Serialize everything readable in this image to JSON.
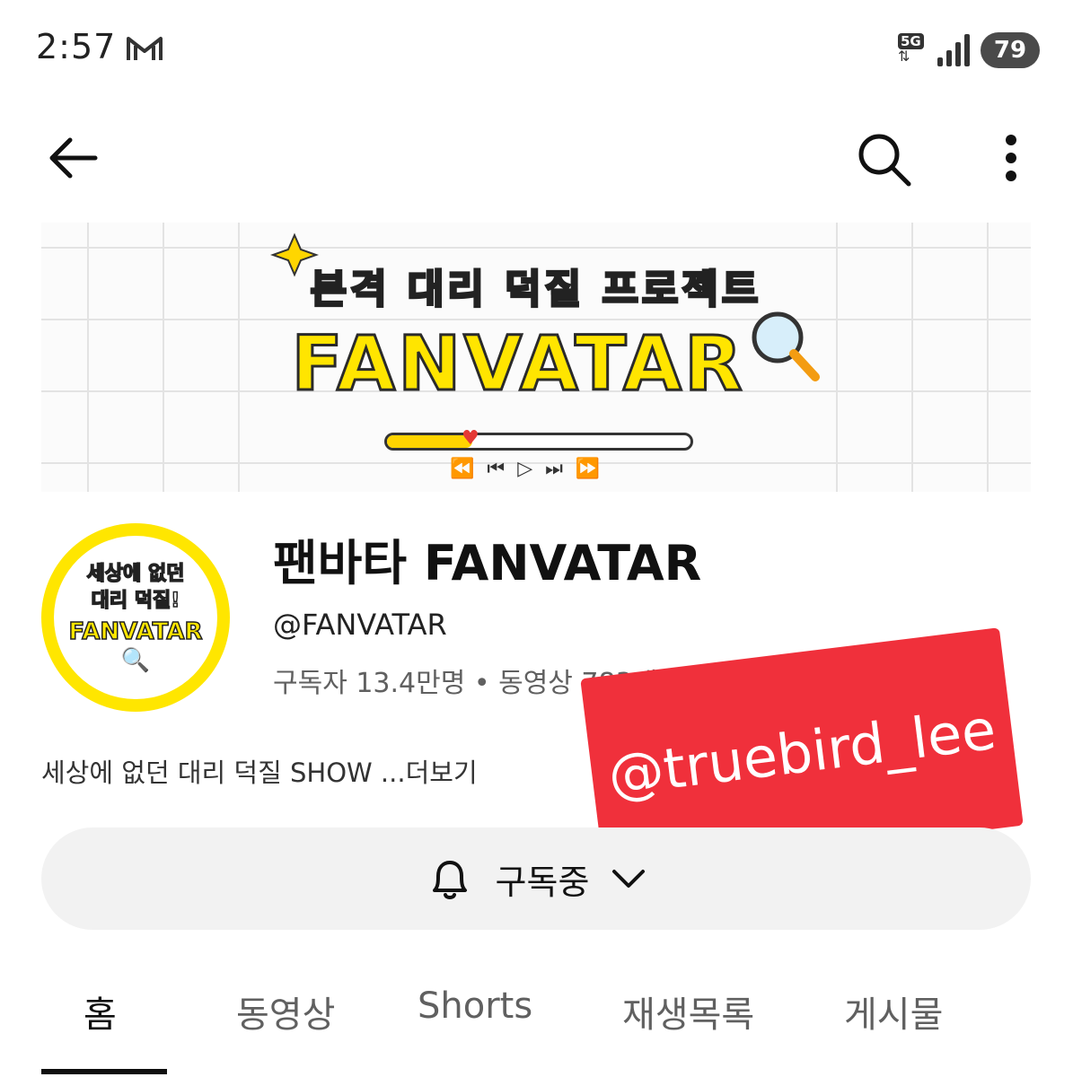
{
  "status_bar": {
    "time": "2:57",
    "network": "5G",
    "battery": "79",
    "icons": [
      "gmail-icon",
      "network-5g-icon",
      "signal-icon",
      "battery-icon"
    ]
  },
  "top_bar": {
    "icons": [
      "back-arrow-icon",
      "search-icon",
      "more-vert-icon"
    ]
  },
  "banner": {
    "subtitle": "본격 대리 덕질 프로젝트",
    "title": "FANVATAR",
    "progress": 0.28,
    "colors": {
      "title": "#ffe500",
      "accent": "#e53935"
    }
  },
  "avatar": {
    "line1": "세상에 없던",
    "line2": "대리 덕질!",
    "brand": "FANVATAR"
  },
  "channel": {
    "name": "팬바타 FANVATAR",
    "handle": "@FANVATAR",
    "stats": "구독자 13.4만명 • 동영상 783개",
    "description": "세상에 없던 대리 덕질 SHOW ...더보기"
  },
  "watermark": {
    "text": "@truebird_lee",
    "color": "#f0303b"
  },
  "subscribe": {
    "label": "구독중",
    "icons": [
      "bell-icon",
      "chevron-down-icon"
    ]
  },
  "tabs": [
    {
      "label": "홈",
      "active": true
    },
    {
      "label": "동영상",
      "active": false
    },
    {
      "label": "Shorts",
      "active": false
    },
    {
      "label": "재생목록",
      "active": false
    },
    {
      "label": "게시물",
      "active": false
    }
  ]
}
